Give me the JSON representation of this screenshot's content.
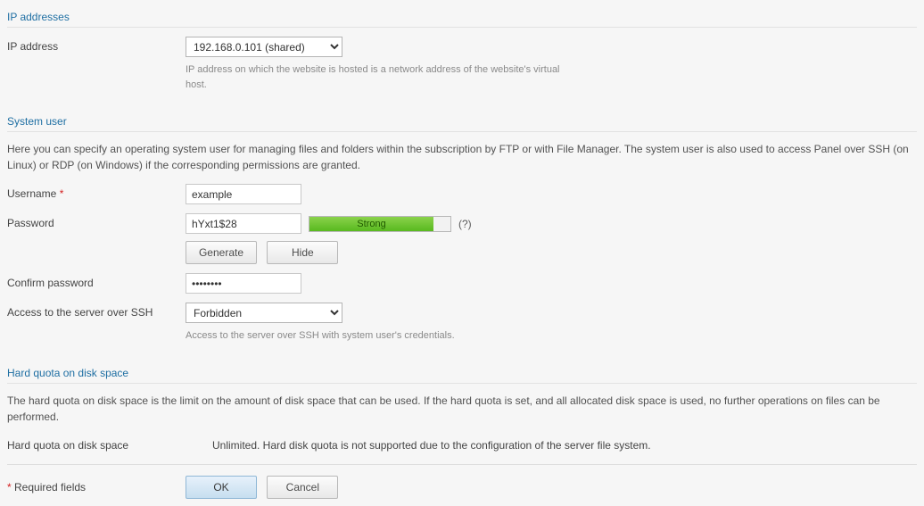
{
  "ip_section": {
    "title": "IP addresses",
    "label": "IP address",
    "selected": "192.168.0.101 (shared)",
    "hint": "IP address on which the website is hosted is a network address of the website's virtual host."
  },
  "user_section": {
    "title": "System user",
    "desc": "Here you can specify an operating system user for managing files and folders within the subscription by FTP or with File Manager. The system user is also used to access Panel over SSH (on Linux) or RDP (on Windows) if the corresponding permissions are granted.",
    "username_label": "Username",
    "username_value": "example",
    "password_label": "Password",
    "password_value": "hYxt1$28",
    "strength_label": "Strong",
    "help_link": "(?)",
    "generate_btn": "Generate",
    "hide_btn": "Hide",
    "confirm_label": "Confirm password",
    "confirm_value": "••••••••",
    "ssh_label": "Access to the server over SSH",
    "ssh_selected": "Forbidden",
    "ssh_hint": "Access to the server over SSH with system user's credentials."
  },
  "quota_section": {
    "title": "Hard quota on disk space",
    "desc": "The hard quota on disk space is the limit on the amount of disk space that can be used. If the hard quota is set, and all allocated disk space is used, no further operations on files can be performed.",
    "label": "Hard quota on disk space",
    "value": "Unlimited. Hard disk quota is not supported due to the configuration of the server file system."
  },
  "footer": {
    "required_mark": "*",
    "required_text": " Required fields",
    "ok": "OK",
    "cancel": "Cancel"
  }
}
